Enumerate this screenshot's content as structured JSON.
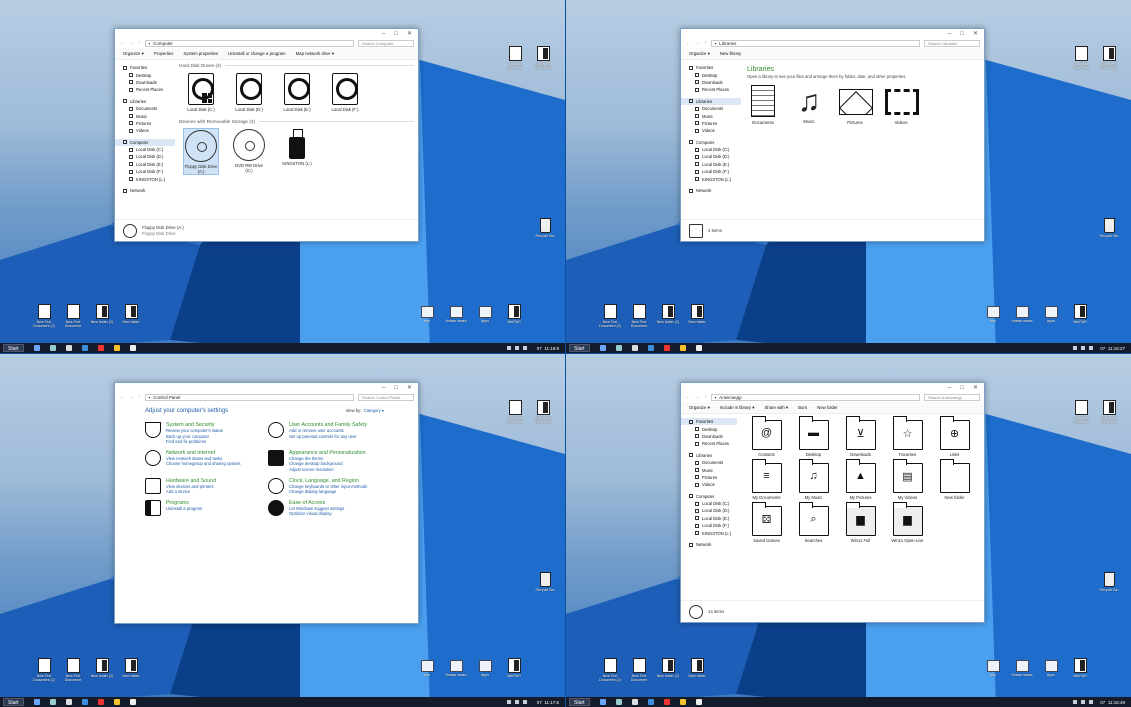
{
  "desktop": {
    "right_icons": [
      "Таблица Excel.xlsx",
      "Документ Word.docx"
    ],
    "recycle_bin": "Recycle Bin",
    "bottom_left_icons": [
      "New Text Document (2)",
      "New Text Document",
      "New folder (2)",
      "New folder"
    ],
    "bottom_right_icons": [
      "test",
      "Новая папка",
      "Apps",
      "WinRAR"
    ]
  },
  "taskbar": {
    "start": "Start",
    "times": [
      "11:16:8",
      "11:16:27",
      "11:17:6",
      "11:16:49"
    ],
    "date": "07"
  },
  "window1": {
    "address": "Computer",
    "search": "Search Computer",
    "commands": [
      "Organize ▾",
      "Properties",
      "System properties",
      "Uninstall or change a program",
      "Map network drive ▾"
    ],
    "nav": [
      "Favorites",
      "Desktop",
      "Downloads",
      "Recent Places",
      "Libraries",
      "Documents",
      "Music",
      "Pictures",
      "Videos",
      "Computer",
      "Local Disk (C:)",
      "Local Disk (D:)",
      "Local Disk (E:)",
      "Local Disk (F:)",
      "KINGSTON (L:)",
      "Network"
    ],
    "group1": "Hard Disk Drives (4)",
    "drives": [
      "Local Disk (C:)",
      "Local Disk (D:)",
      "Local Disk (E:)",
      "Local Disk (F:)"
    ],
    "group2": "Devices with Removable Storage (3)",
    "removable": [
      "Floppy Disk Drive (A:)",
      "DVD RW Drive (G:)",
      "KINGSTON (L:)"
    ],
    "details_name": "Floppy Disk Drive (A:)",
    "details_type": "Floppy Disk Drive"
  },
  "window2": {
    "address": "Libraries",
    "search": "Search Libraries",
    "commands": [
      "Organize ▾",
      "New library"
    ],
    "title": "Libraries",
    "subtitle": "Open a library to see your files and arrange them by folder, date, and other properties.",
    "libraries": [
      "Documents",
      "Music",
      "Pictures",
      "Videos"
    ],
    "count": "4 items"
  },
  "window3": {
    "address": "Control Panel",
    "search": "Search Control Panel",
    "heading": "Adjust your computer's settings",
    "view_by_label": "View by:",
    "view_by_value": "Category ▾",
    "items": [
      {
        "title": "System and Security",
        "links": [
          "Review your computer's status",
          "Back up your computer",
          "Find and fix problems"
        ]
      },
      {
        "title": "User Accounts and Family Safety",
        "links": [
          "Add or remove user accounts",
          "Set up parental controls for any user"
        ]
      },
      {
        "title": "Network and Internet",
        "links": [
          "View network status and tasks",
          "Choose homegroup and sharing options"
        ]
      },
      {
        "title": "Appearance and Personalization",
        "links": [
          "Change the theme",
          "Change desktop background",
          "Adjust screen resolution"
        ]
      },
      {
        "title": "Hardware and Sound",
        "links": [
          "View devices and printers",
          "Add a device"
        ]
      },
      {
        "title": "Clock, Language, and Region",
        "links": [
          "Change keyboards or other input methods",
          "Change display language"
        ]
      },
      {
        "title": "Programs",
        "links": [
          "Uninstall a program"
        ]
      },
      {
        "title": "Ease of Access",
        "links": [
          "Let Windows suggest settings",
          "Optimize visual display"
        ]
      }
    ]
  },
  "window4": {
    "address": "Александр",
    "search": "Search Александр",
    "commands": [
      "Organize ▾",
      "Include in library ▾",
      "Share with ▾",
      "Burn",
      "New folder"
    ],
    "folders": [
      "Contacts",
      "Desktop",
      "Downloads",
      "Favorites",
      "Links",
      "My Documents",
      "My Music",
      "My Pictures",
      "My Videos",
      "New folder",
      "Saved Games",
      "Searches",
      "Win11 Full",
      "Win11 Open-Live"
    ],
    "count": "14 items"
  }
}
